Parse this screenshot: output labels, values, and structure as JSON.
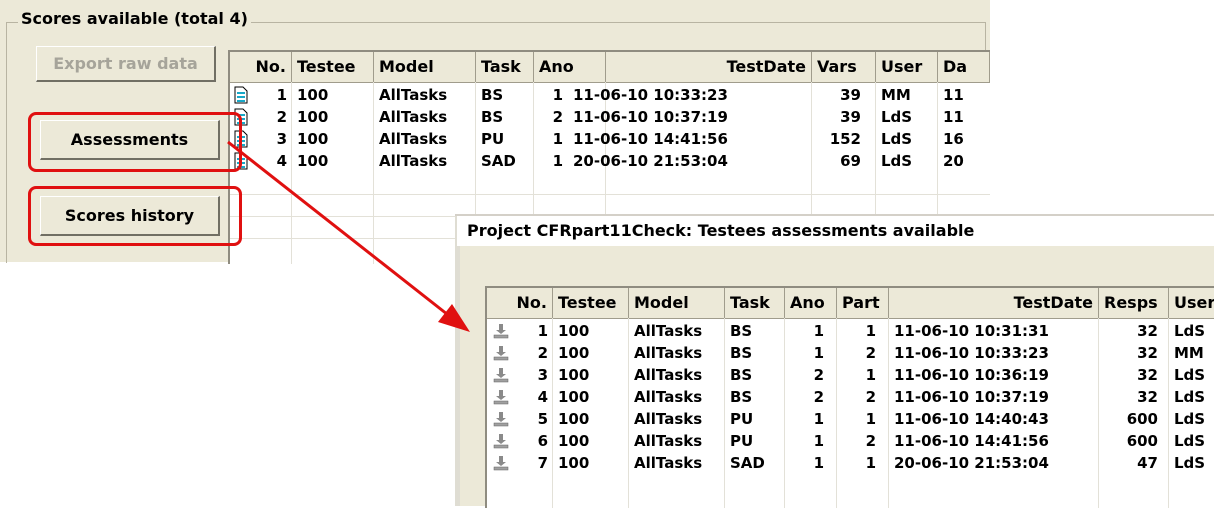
{
  "scores_panel": {
    "group_title": "Scores available (total 4)",
    "export_label": "Export raw data",
    "assessments_label": "Assessments",
    "history_label": "Scores history",
    "columns": [
      "No.",
      "Testee",
      "Model",
      "Task",
      "Ano",
      "TestDate",
      "Vars",
      "User",
      "Da"
    ],
    "rows": [
      {
        "no": "1",
        "testee": "100",
        "model": "AllTasks",
        "task": "BS",
        "ano": "1",
        "date": "11-06-10 10:33:23",
        "vars": "39",
        "user": "MM",
        "da": "11"
      },
      {
        "no": "2",
        "testee": "100",
        "model": "AllTasks",
        "task": "BS",
        "ano": "2",
        "date": "11-06-10 10:37:19",
        "vars": "39",
        "user": "LdS",
        "da": "11"
      },
      {
        "no": "3",
        "testee": "100",
        "model": "AllTasks",
        "task": "PU",
        "ano": "1",
        "date": "11-06-10 14:41:56",
        "vars": "152",
        "user": "LdS",
        "da": "16"
      },
      {
        "no": "4",
        "testee": "100",
        "model": "AllTasks",
        "task": "SAD",
        "ano": "1",
        "date": "20-06-10 21:53:04",
        "vars": "69",
        "user": "LdS",
        "da": "20"
      }
    ]
  },
  "dialog": {
    "title": "Project CFRpart11Check: Testees assessments available",
    "columns": [
      "No.",
      "Testee",
      "Model",
      "Task",
      "Ano",
      "Part",
      "TestDate",
      "Resps",
      "User"
    ],
    "rows": [
      {
        "no": "1",
        "testee": "100",
        "model": "AllTasks",
        "task": "BS",
        "ano": "1",
        "part": "1",
        "date": "11-06-10 10:31:31",
        "resps": "32",
        "user": "LdS"
      },
      {
        "no": "2",
        "testee": "100",
        "model": "AllTasks",
        "task": "BS",
        "ano": "1",
        "part": "2",
        "date": "11-06-10 10:33:23",
        "resps": "32",
        "user": "MM"
      },
      {
        "no": "3",
        "testee": "100",
        "model": "AllTasks",
        "task": "BS",
        "ano": "2",
        "part": "1",
        "date": "11-06-10 10:36:19",
        "resps": "32",
        "user": "LdS"
      },
      {
        "no": "4",
        "testee": "100",
        "model": "AllTasks",
        "task": "BS",
        "ano": "2",
        "part": "2",
        "date": "11-06-10 10:37:19",
        "resps": "32",
        "user": "LdS"
      },
      {
        "no": "5",
        "testee": "100",
        "model": "AllTasks",
        "task": "PU",
        "ano": "1",
        "part": "1",
        "date": "11-06-10 14:40:43",
        "resps": "600",
        "user": "LdS"
      },
      {
        "no": "6",
        "testee": "100",
        "model": "AllTasks",
        "task": "PU",
        "ano": "1",
        "part": "2",
        "date": "11-06-10 14:41:56",
        "resps": "600",
        "user": "LdS"
      },
      {
        "no": "7",
        "testee": "100",
        "model": "AllTasks",
        "task": "SAD",
        "ano": "1",
        "part": "1",
        "date": "20-06-10 21:53:04",
        "resps": "47",
        "user": "LdS"
      }
    ]
  },
  "icons": {
    "score_row": "document-icon",
    "assessment_row": "download-icon"
  },
  "colors": {
    "highlight": "#e01010",
    "doc_icon": "#18a8c8"
  }
}
